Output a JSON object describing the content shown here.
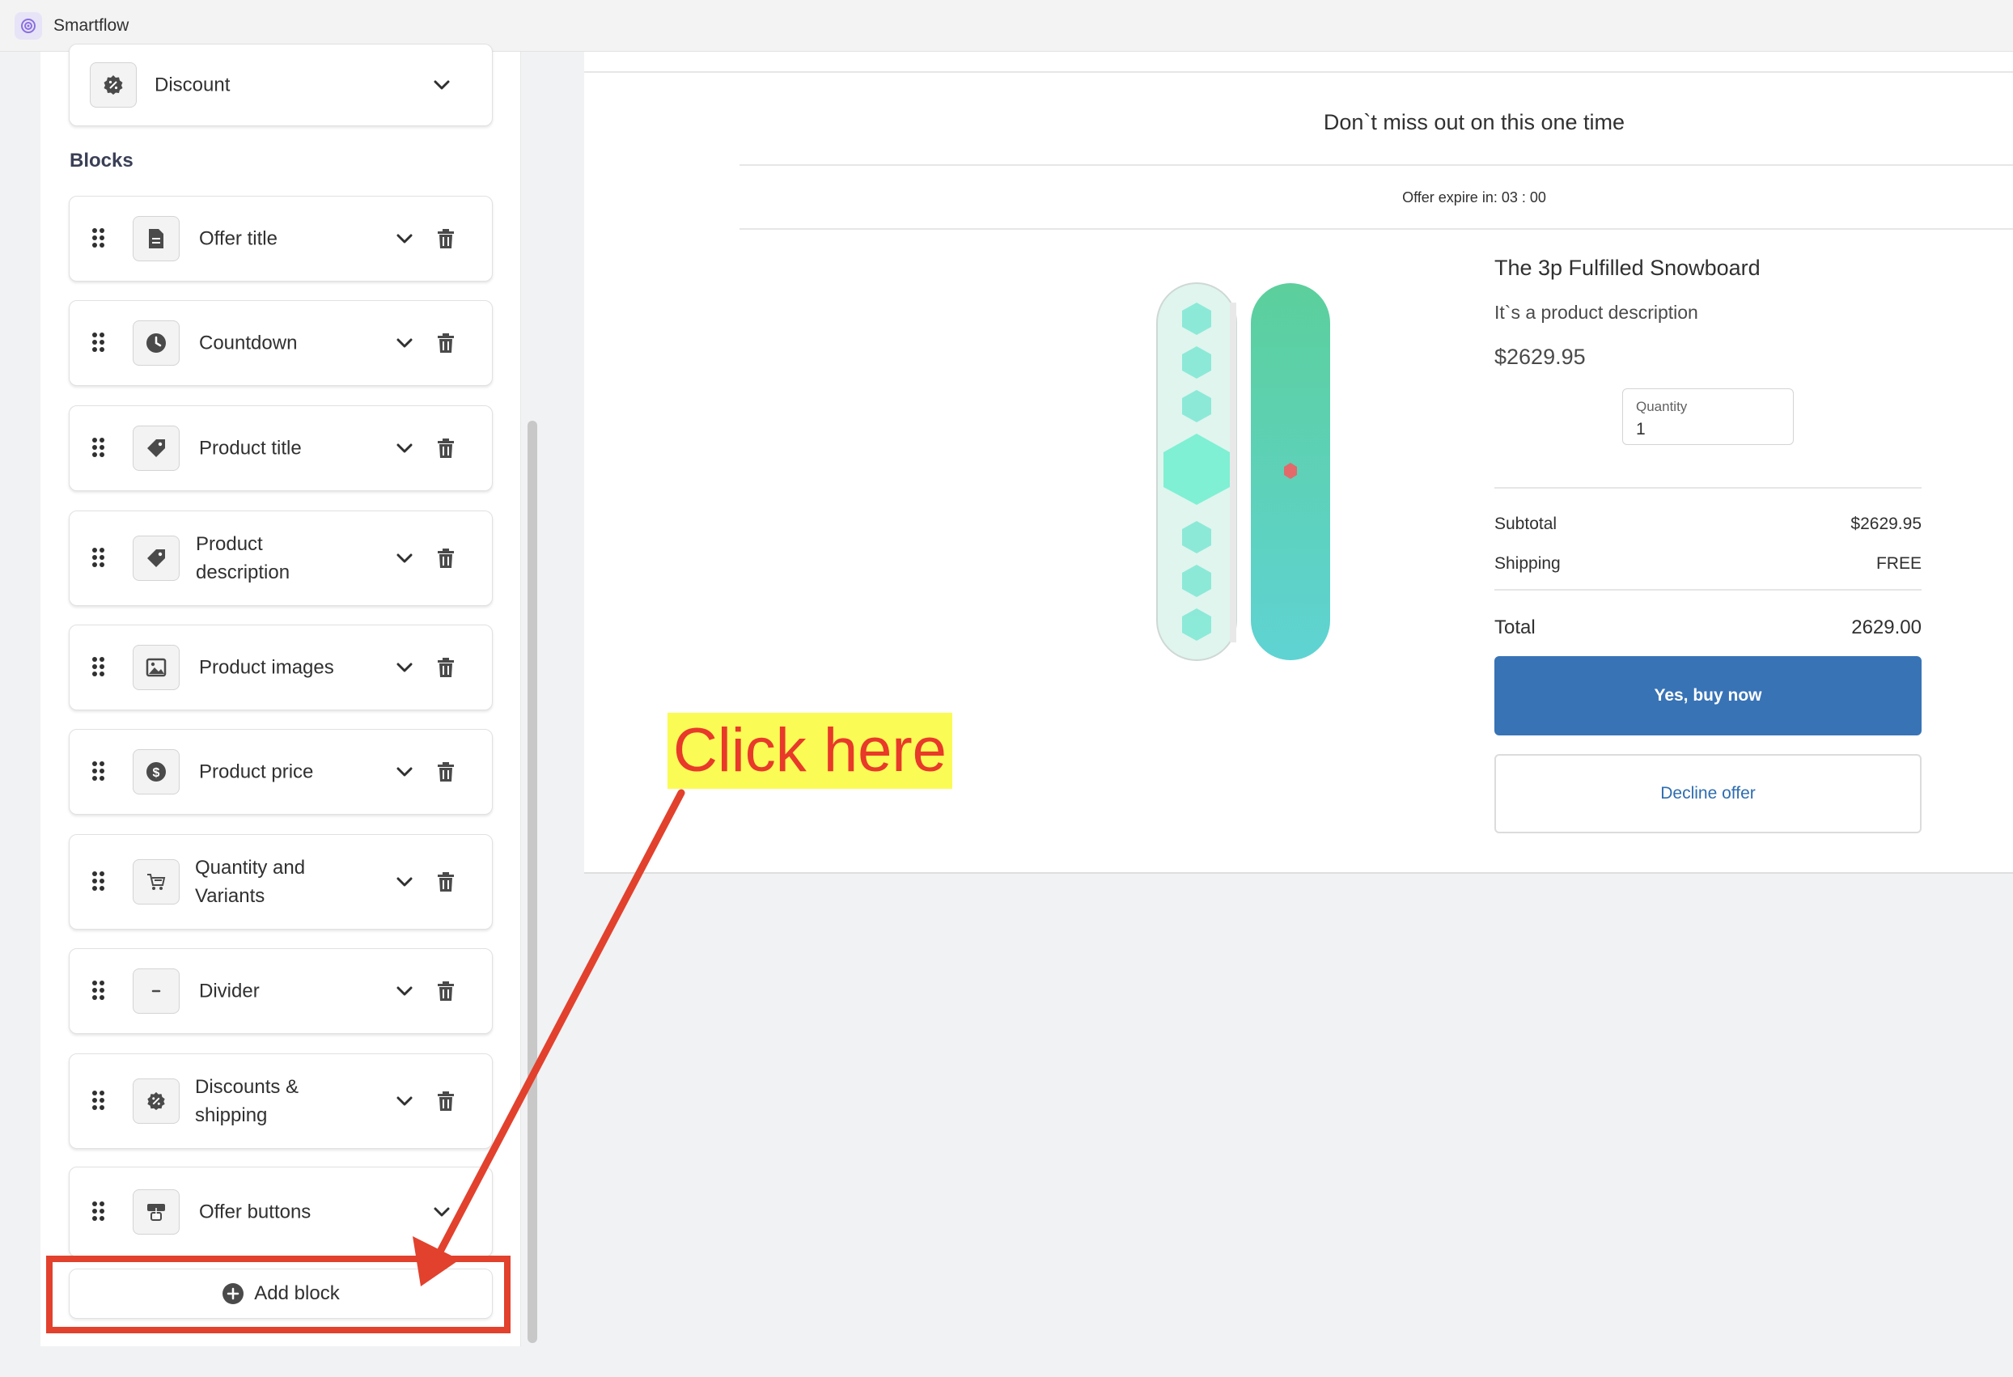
{
  "app": {
    "title": "Smartflow"
  },
  "sidebar": {
    "discount_label": "Discount",
    "blocks_heading": "Blocks",
    "blocks": [
      {
        "label": "Offer title",
        "icon": "document-icon"
      },
      {
        "label": "Countdown",
        "icon": "clock-icon"
      },
      {
        "label": "Product title",
        "icon": "tag-icon"
      },
      {
        "label": "Product description",
        "icon": "tag-icon"
      },
      {
        "label": "Product images",
        "icon": "image-icon"
      },
      {
        "label": "Product price",
        "icon": "dollar-icon"
      },
      {
        "label": "Quantity and Variants",
        "icon": "cart-icon"
      },
      {
        "label": "Divider",
        "icon": "minus-icon"
      },
      {
        "label": "Discounts & shipping",
        "icon": "discount-icon"
      },
      {
        "label": "Offer buttons",
        "icon": "buttons-icon"
      }
    ],
    "add_block_label": "Add block"
  },
  "preview": {
    "offer_title": "Don`t miss out on this one time",
    "countdown_text": "Offer expire in: 03 : 00",
    "product_title": "The 3p Fulfilled Snowboard",
    "product_description": "It`s a product description",
    "product_price": "$2629.95",
    "quantity_label": "Quantity",
    "quantity_value": "1",
    "summary": {
      "subtotal_label": "Subtotal",
      "subtotal_value": "$2629.95",
      "shipping_label": "Shipping",
      "shipping_value": "FREE",
      "total_label": "Total",
      "total_value": "2629.00"
    },
    "buy_button": "Yes, buy now",
    "decline_button": "Decline offer"
  },
  "annotation": {
    "text": "Click here",
    "color": "#e8392a",
    "highlight": "#fbfb55"
  },
  "colors": {
    "primary_button": "#3873b6",
    "link": "#2e6db0",
    "snowboard_mint": "#dff5ee",
    "snowboard_teal": "#5ccfb5"
  }
}
